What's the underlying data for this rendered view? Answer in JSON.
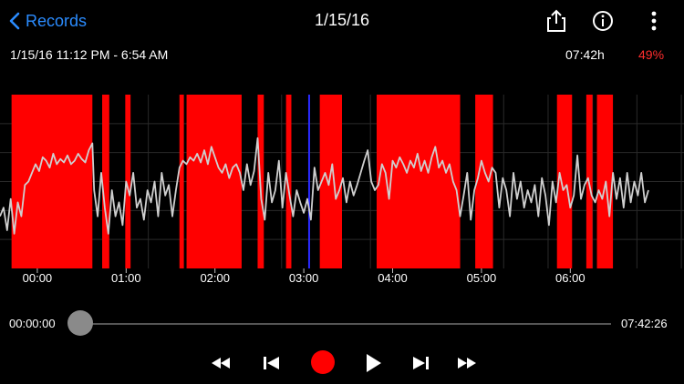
{
  "nav": {
    "back_label": "Records",
    "title": "1/15/16"
  },
  "info": {
    "range": "1/15/16 11:12 PM - 6:54 AM",
    "duration": "07:42h",
    "percent": "49%"
  },
  "colors": {
    "accent": "#2b8cff",
    "highlight": "#ff0000",
    "marker": "#2a2aff",
    "signal": "#cfcfcf"
  },
  "chart_data": {
    "type": "line",
    "x_unit": "hours since 00:00",
    "x_range": [
      -0.42,
      7.28
    ],
    "tick_labels": [
      "00:00",
      "01:00",
      "02:00",
      "03:00",
      "04:00",
      "05:00",
      "06:00"
    ],
    "tick_values": [
      0,
      1,
      2,
      3,
      4,
      5,
      6
    ],
    "red_bands": [
      [
        -0.29,
        0.62
      ],
      [
        0.73,
        0.81
      ],
      [
        0.99,
        1.05
      ],
      [
        1.6,
        1.65
      ],
      [
        1.68,
        2.3
      ],
      [
        2.48,
        2.55
      ],
      [
        2.8,
        2.86
      ],
      [
        3.18,
        3.43
      ],
      [
        3.82,
        4.76
      ],
      [
        4.93,
        5.13
      ],
      [
        5.85,
        6.02
      ],
      [
        6.18,
        6.25
      ],
      [
        6.3,
        6.48
      ]
    ],
    "markers": [
      3.06
    ],
    "signal": [
      [
        -0.42,
        0.3
      ],
      [
        -0.38,
        0.35
      ],
      [
        -0.34,
        0.22
      ],
      [
        -0.3,
        0.4
      ],
      [
        -0.26,
        0.2
      ],
      [
        -0.22,
        0.38
      ],
      [
        -0.18,
        0.3
      ],
      [
        -0.14,
        0.48
      ],
      [
        -0.1,
        0.5
      ],
      [
        -0.06,
        0.55
      ],
      [
        -0.02,
        0.6
      ],
      [
        0.02,
        0.56
      ],
      [
        0.06,
        0.64
      ],
      [
        0.1,
        0.62
      ],
      [
        0.14,
        0.58
      ],
      [
        0.18,
        0.66
      ],
      [
        0.22,
        0.6
      ],
      [
        0.26,
        0.63
      ],
      [
        0.3,
        0.61
      ],
      [
        0.34,
        0.65
      ],
      [
        0.38,
        0.6
      ],
      [
        0.42,
        0.62
      ],
      [
        0.46,
        0.66
      ],
      [
        0.5,
        0.63
      ],
      [
        0.54,
        0.61
      ],
      [
        0.58,
        0.68
      ],
      [
        0.62,
        0.72
      ],
      [
        0.64,
        0.45
      ],
      [
        0.68,
        0.3
      ],
      [
        0.72,
        0.55
      ],
      [
        0.76,
        0.35
      ],
      [
        0.8,
        0.2
      ],
      [
        0.84,
        0.45
      ],
      [
        0.88,
        0.3
      ],
      [
        0.92,
        0.38
      ],
      [
        0.96,
        0.25
      ],
      [
        1.0,
        0.5
      ],
      [
        1.04,
        0.42
      ],
      [
        1.08,
        0.55
      ],
      [
        1.12,
        0.35
      ],
      [
        1.16,
        0.4
      ],
      [
        1.2,
        0.28
      ],
      [
        1.24,
        0.45
      ],
      [
        1.28,
        0.38
      ],
      [
        1.32,
        0.5
      ],
      [
        1.36,
        0.3
      ],
      [
        1.4,
        0.55
      ],
      [
        1.44,
        0.42
      ],
      [
        1.48,
        0.48
      ],
      [
        1.52,
        0.3
      ],
      [
        1.56,
        0.45
      ],
      [
        1.6,
        0.58
      ],
      [
        1.64,
        0.62
      ],
      [
        1.68,
        0.6
      ],
      [
        1.72,
        0.64
      ],
      [
        1.76,
        0.62
      ],
      [
        1.8,
        0.66
      ],
      [
        1.84,
        0.61
      ],
      [
        1.88,
        0.68
      ],
      [
        1.92,
        0.6
      ],
      [
        1.96,
        0.7
      ],
      [
        2.0,
        0.64
      ],
      [
        2.04,
        0.58
      ],
      [
        2.08,
        0.55
      ],
      [
        2.12,
        0.6
      ],
      [
        2.16,
        0.52
      ],
      [
        2.2,
        0.58
      ],
      [
        2.24,
        0.6
      ],
      [
        2.28,
        0.55
      ],
      [
        2.32,
        0.45
      ],
      [
        2.36,
        0.6
      ],
      [
        2.4,
        0.48
      ],
      [
        2.44,
        0.56
      ],
      [
        2.48,
        0.75
      ],
      [
        2.52,
        0.4
      ],
      [
        2.56,
        0.28
      ],
      [
        2.6,
        0.55
      ],
      [
        2.64,
        0.38
      ],
      [
        2.68,
        0.45
      ],
      [
        2.72,
        0.62
      ],
      [
        2.76,
        0.35
      ],
      [
        2.8,
        0.55
      ],
      [
        2.84,
        0.42
      ],
      [
        2.88,
        0.3
      ],
      [
        2.92,
        0.45
      ],
      [
        2.96,
        0.38
      ],
      [
        3.0,
        0.32
      ],
      [
        3.04,
        0.4
      ],
      [
        3.08,
        0.28
      ],
      [
        3.12,
        0.58
      ],
      [
        3.16,
        0.45
      ],
      [
        3.2,
        0.5
      ],
      [
        3.24,
        0.55
      ],
      [
        3.28,
        0.48
      ],
      [
        3.32,
        0.6
      ],
      [
        3.36,
        0.4
      ],
      [
        3.4,
        0.45
      ],
      [
        3.44,
        0.52
      ],
      [
        3.48,
        0.38
      ],
      [
        3.52,
        0.5
      ],
      [
        3.56,
        0.42
      ],
      [
        3.6,
        0.48
      ],
      [
        3.64,
        0.55
      ],
      [
        3.68,
        0.62
      ],
      [
        3.72,
        0.68
      ],
      [
        3.76,
        0.5
      ],
      [
        3.8,
        0.45
      ],
      [
        3.84,
        0.48
      ],
      [
        3.88,
        0.6
      ],
      [
        3.92,
        0.55
      ],
      [
        3.96,
        0.4
      ],
      [
        4.0,
        0.62
      ],
      [
        4.04,
        0.58
      ],
      [
        4.08,
        0.64
      ],
      [
        4.12,
        0.6
      ],
      [
        4.16,
        0.55
      ],
      [
        4.2,
        0.62
      ],
      [
        4.24,
        0.58
      ],
      [
        4.28,
        0.66
      ],
      [
        4.32,
        0.56
      ],
      [
        4.36,
        0.62
      ],
      [
        4.4,
        0.55
      ],
      [
        4.44,
        0.64
      ],
      [
        4.48,
        0.7
      ],
      [
        4.52,
        0.58
      ],
      [
        4.56,
        0.62
      ],
      [
        4.6,
        0.55
      ],
      [
        4.64,
        0.6
      ],
      [
        4.68,
        0.5
      ],
      [
        4.72,
        0.45
      ],
      [
        4.76,
        0.3
      ],
      [
        4.8,
        0.42
      ],
      [
        4.84,
        0.55
      ],
      [
        4.88,
        0.28
      ],
      [
        4.92,
        0.45
      ],
      [
        4.96,
        0.52
      ],
      [
        5.0,
        0.62
      ],
      [
        5.04,
        0.55
      ],
      [
        5.08,
        0.5
      ],
      [
        5.12,
        0.58
      ],
      [
        5.16,
        0.55
      ],
      [
        5.2,
        0.35
      ],
      [
        5.24,
        0.52
      ],
      [
        5.28,
        0.45
      ],
      [
        5.32,
        0.3
      ],
      [
        5.36,
        0.55
      ],
      [
        5.4,
        0.4
      ],
      [
        5.44,
        0.5
      ],
      [
        5.48,
        0.35
      ],
      [
        5.52,
        0.45
      ],
      [
        5.56,
        0.38
      ],
      [
        5.6,
        0.48
      ],
      [
        5.64,
        0.3
      ],
      [
        5.68,
        0.52
      ],
      [
        5.72,
        0.42
      ],
      [
        5.76,
        0.25
      ],
      [
        5.8,
        0.5
      ],
      [
        5.84,
        0.38
      ],
      [
        5.88,
        0.55
      ],
      [
        5.92,
        0.45
      ],
      [
        5.96,
        0.48
      ],
      [
        6.0,
        0.35
      ],
      [
        6.04,
        0.42
      ],
      [
        6.08,
        0.65
      ],
      [
        6.12,
        0.4
      ],
      [
        6.16,
        0.48
      ],
      [
        6.2,
        0.52
      ],
      [
        6.24,
        0.42
      ],
      [
        6.28,
        0.38
      ],
      [
        6.32,
        0.45
      ],
      [
        6.36,
        0.4
      ],
      [
        6.4,
        0.5
      ],
      [
        6.44,
        0.3
      ],
      [
        6.48,
        0.55
      ],
      [
        6.52,
        0.4
      ],
      [
        6.56,
        0.52
      ],
      [
        6.6,
        0.35
      ],
      [
        6.64,
        0.55
      ],
      [
        6.68,
        0.38
      ],
      [
        6.72,
        0.5
      ],
      [
        6.76,
        0.42
      ],
      [
        6.8,
        0.55
      ],
      [
        6.84,
        0.38
      ],
      [
        6.88,
        0.45
      ]
    ]
  },
  "playback": {
    "current_time": "00:00:00",
    "total_time": "07:42:26",
    "progress": 0
  }
}
